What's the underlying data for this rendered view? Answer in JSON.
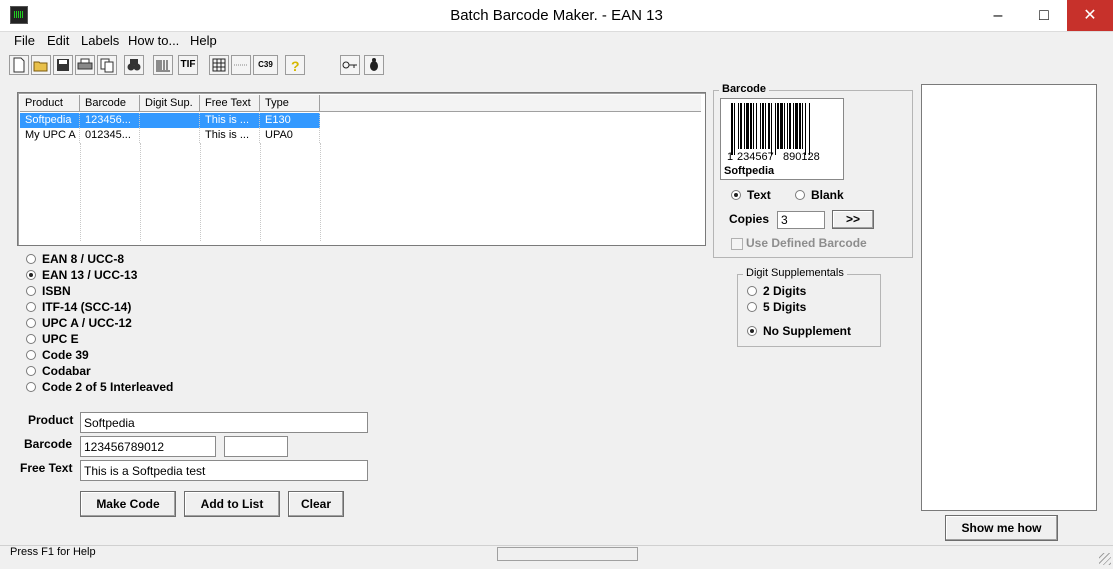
{
  "window": {
    "title": "Batch Barcode Maker.  - EAN 13",
    "minimize": "–",
    "maximize": "□",
    "close": "✕"
  },
  "menu": [
    "File",
    "Edit",
    "Labels",
    "How to...",
    "Help"
  ],
  "toolbar": {
    "icons": [
      "new-file-icon",
      "open-folder-icon",
      "save-icon",
      "print-icon",
      "copy-icon",
      "find-icon",
      "resize-barcode-icon",
      "tif-export-icon",
      "grid-icon",
      "barcode-strip-icon",
      "code39-icon",
      "help-icon",
      "key-icon",
      "bug-icon"
    ],
    "tif": "TIF",
    "c39": "C39"
  },
  "table": {
    "columns": [
      "Product",
      "Barcode",
      "Digit Sup.",
      "Free Text",
      "Type"
    ],
    "rows": [
      [
        "Softpedia",
        "123456...",
        "",
        "This is ...",
        "E130"
      ],
      [
        "My UPC A",
        "012345...",
        "",
        "This is ...",
        "UPA0"
      ]
    ]
  },
  "symbologies": [
    {
      "label": "EAN 8 / UCC-8",
      "selected": false
    },
    {
      "label": "EAN 13 / UCC-13",
      "selected": true
    },
    {
      "label": "ISBN",
      "selected": false
    },
    {
      "label": "ITF-14 (SCC-14)",
      "selected": false
    },
    {
      "label": "UPC A / UCC-12",
      "selected": false
    },
    {
      "label": "UPC E",
      "selected": false
    },
    {
      "label": "Code 39",
      "selected": false
    },
    {
      "label": "Codabar",
      "selected": false
    },
    {
      "label": "Code 2 of 5 Interleaved",
      "selected": false
    }
  ],
  "form": {
    "product_label": "Product",
    "product_value": "Softpedia",
    "barcode_label": "Barcode",
    "barcode_value": "123456789012",
    "barcode_sup_value": "",
    "freetext_label": "Free Text",
    "freetext_value": "This is a Softpedia test"
  },
  "buttons": {
    "make_code": "Make Code",
    "add_to_list": "Add to List",
    "clear": "Clear",
    "show_me_how": "Show me how"
  },
  "barcode_panel": {
    "title": "Barcode",
    "digits_first": "1",
    "digits_left": "234567",
    "digits_right": "890128",
    "caption": "Softpedia",
    "text_option": "Text",
    "blank_option": "Blank",
    "copies_label": "Copies",
    "copies_value": "3",
    "copies_button": ">>",
    "use_defined": "Use Defined Barcode"
  },
  "supplementals": {
    "title": "Digit Supplementals",
    "options": [
      {
        "label": "2 Digits",
        "selected": false
      },
      {
        "label": "5 Digits",
        "selected": false
      },
      {
        "label": "No Supplement",
        "selected": true
      }
    ]
  },
  "status": {
    "text": "Press F1 for Help"
  }
}
